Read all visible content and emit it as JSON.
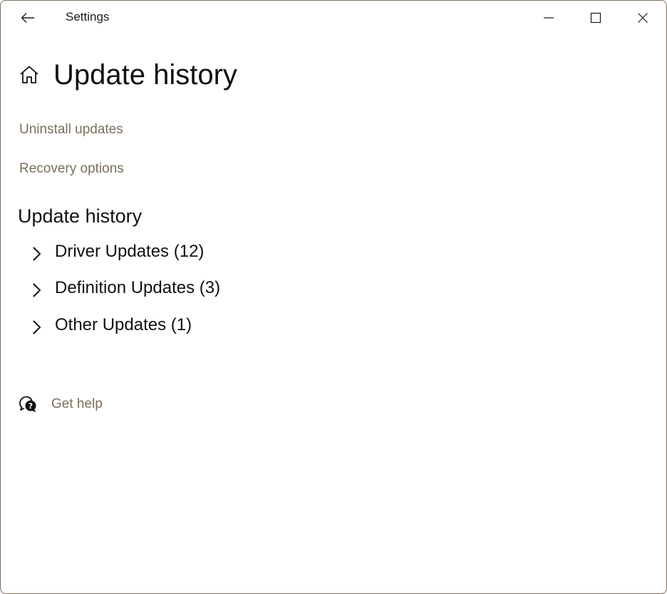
{
  "window": {
    "title": "Settings",
    "controls": {
      "back": "back-arrow-icon",
      "minimize": "minimize-icon",
      "maximize": "maximize-icon",
      "close": "close-icon"
    }
  },
  "header": {
    "icon": "home-icon",
    "title": "Update history"
  },
  "links": {
    "uninstall": "Uninstall updates",
    "recovery": "Recovery options"
  },
  "section": {
    "title": "Update history",
    "groups": [
      {
        "label": "Driver Updates (12)",
        "icon": "chevron-right-icon"
      },
      {
        "label": "Definition Updates (3)",
        "icon": "chevron-right-icon"
      },
      {
        "label": "Other Updates (1)",
        "icon": "chevron-right-icon"
      }
    ]
  },
  "help": {
    "icon": "chat-help-icon",
    "label": "Get help"
  },
  "colors": {
    "accent_link": "#7a6f5c",
    "text": "#111111",
    "window_border": "#7a6f5c",
    "background": "#ffffff"
  }
}
